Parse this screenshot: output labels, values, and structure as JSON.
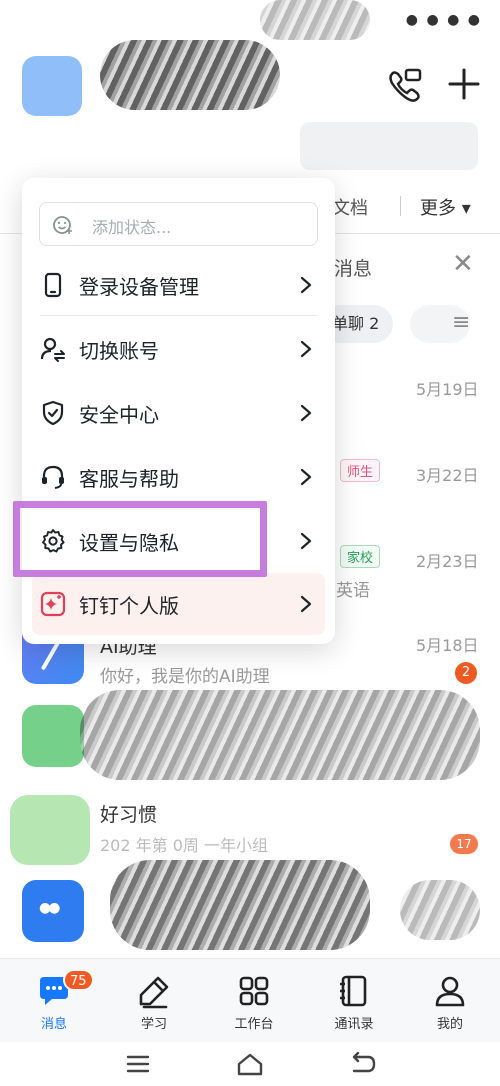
{
  "status_bar": {
    "icons": "● ● ● ●"
  },
  "header": {
    "call_icon": "phone-video-icon",
    "add_icon": "plus-icon"
  },
  "tabs": {
    "docs": "文档",
    "more": "更多 ▾"
  },
  "panel": {
    "title": "消息",
    "close": "✕",
    "chip_single": "单聊 2",
    "list_icon": "≡"
  },
  "rows": [
    {
      "date": "5月19日"
    },
    {
      "tag": "师生",
      "date": "3月22日"
    },
    {
      "tag": "家校",
      "date": "2月23日",
      "preview": "英语"
    },
    {
      "name": "AI助理",
      "preview": "你好，我是你的AI助理",
      "date": "5月18日",
      "badge": "2"
    },
    {
      "name": "好习惯",
      "preview": "202 年第 0周 一年小组",
      "badge": "17"
    }
  ],
  "popup": {
    "status_placeholder": "添加状态...",
    "items": [
      {
        "label": "登录设备管理",
        "icon": "phone-device-icon"
      },
      {
        "label": "切换账号",
        "icon": "switch-account-icon"
      },
      {
        "label": "安全中心",
        "icon": "shield-check-icon"
      },
      {
        "label": "客服与帮助",
        "icon": "headset-icon"
      },
      {
        "label": "设置与隐私",
        "icon": "gear-icon"
      },
      {
        "label": "钉钉个人版",
        "icon": "sparkle-icon"
      }
    ]
  },
  "bottom_nav": {
    "items": [
      {
        "label": "消息",
        "badge": "75",
        "active": true
      },
      {
        "label": "学习"
      },
      {
        "label": "工作台"
      },
      {
        "label": "通讯录"
      },
      {
        "label": "我的"
      }
    ]
  },
  "colors": {
    "accent": "#1677ff",
    "badge": "#f05a22",
    "highlight": "#c77dde"
  }
}
